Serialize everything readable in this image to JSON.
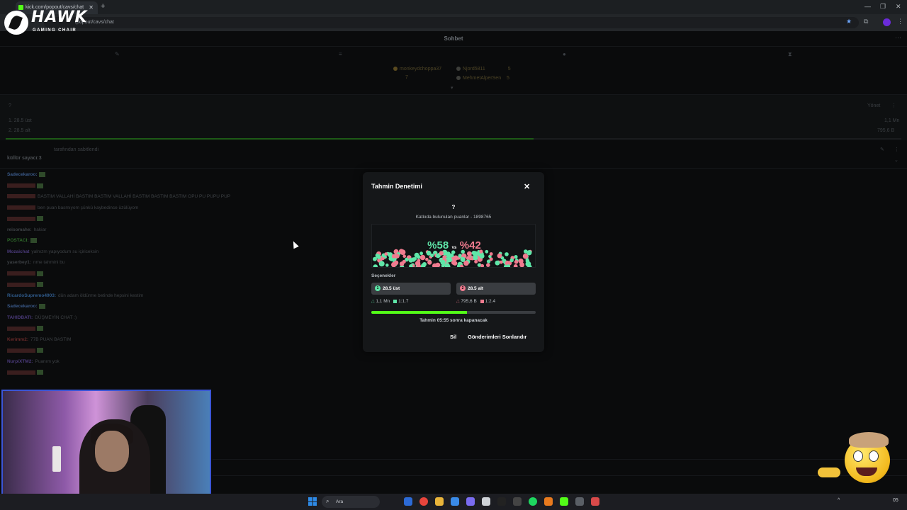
{
  "browser": {
    "tab_title": "kick.com/popout/cavs/chat",
    "url": "kick.com/popout/cavs/chat",
    "url_visible": "/popout/cavs/chat"
  },
  "logo": {
    "name": "HAWK",
    "sub": "GAMING CHAIR"
  },
  "chat": {
    "title": "Sohbet",
    "gifters": [
      {
        "name": "monkeydchoppa37",
        "count": "7"
      },
      {
        "name": "Njord5811",
        "count": "5"
      },
      {
        "name": "MehmetAlperSen",
        "count": "5"
      }
    ]
  },
  "prediction_panel": {
    "question": "?",
    "manage_label": "Yönet",
    "option1": "1. 28.5 üst",
    "option2": "2. 28.5 alt",
    "amount1": "1,1 Mn",
    "amount2": "795,6 B",
    "progress": 0.58
  },
  "pinned": {
    "by": "tarafından sabitlendi",
    "text": "küllür sayacı:3"
  },
  "chat_lines": [
    {
      "user": "Sadecekaroo:",
      "text": ""
    },
    {
      "user": "",
      "text": ""
    },
    {
      "user": "",
      "text": "BASTIM VALLAHİ BASTIM BASTIM VALLAHİ BASTIM BASTIM BASTIM OPU PU PUPU PUP"
    },
    {
      "user": "",
      "text": "ben puan basmıyom çünkü kaybedince üzülüyom"
    },
    {
      "user": "",
      "text": ""
    },
    {
      "user": "reisomahe:",
      "text": "hakiar"
    },
    {
      "user": "POSTACI:",
      "text": ""
    },
    {
      "user": "Mozaichat",
      "text": "yalnızm yapıyodum su içiriceksin"
    },
    {
      "user": "yaserbey1:",
      "text": "nme tahmini bu"
    },
    {
      "user": "",
      "text": ""
    },
    {
      "user": "",
      "text": ""
    },
    {
      "user": "RicardoSupremo4903:",
      "text": "dün adam öldürme betinde hepsini kestim"
    },
    {
      "user": "Sadecekaroo:",
      "text": ""
    },
    {
      "user": "TAHIDBATI:",
      "text": "DÜŞMEYİN CHAT :)"
    },
    {
      "user": "",
      "text": ""
    },
    {
      "user": "Kerimm2:",
      "text": "77B PUAN BASTIM"
    },
    {
      "user": "",
      "text": ""
    },
    {
      "user": "NurpiXTM2:",
      "text": "Puanım yok"
    },
    {
      "user": "",
      "text": ""
    }
  ],
  "modal": {
    "title": "Tahmin Denetimi",
    "close": "✕",
    "question": "?",
    "subtitle": "Katkıda bulunulan puanlar - 1898765",
    "pct_a": "%58",
    "vs": "vs",
    "pct_b": "%42",
    "options_label": "Seçenekler",
    "option_a": {
      "label": "28.5 üst",
      "amount": "1,1 Mn",
      "ratio": "1:1.7",
      "color": "#5fe6a8"
    },
    "option_b": {
      "label": "28.5 alt",
      "amount": "795,6 B",
      "ratio": "1:2.4",
      "color": "#f07b8f"
    },
    "progress": 0.58,
    "timer_text": "Tahmin 05:55 sonra kapanacak",
    "delete_label": "Sil",
    "end_label": "Gönderimleri Sonlandır"
  },
  "taskbar": {
    "search_label": "Ara",
    "time": "05"
  },
  "colors": {
    "accent": "#53fc18",
    "option_a": "#5fe6a8",
    "option_b": "#f07b8f"
  }
}
